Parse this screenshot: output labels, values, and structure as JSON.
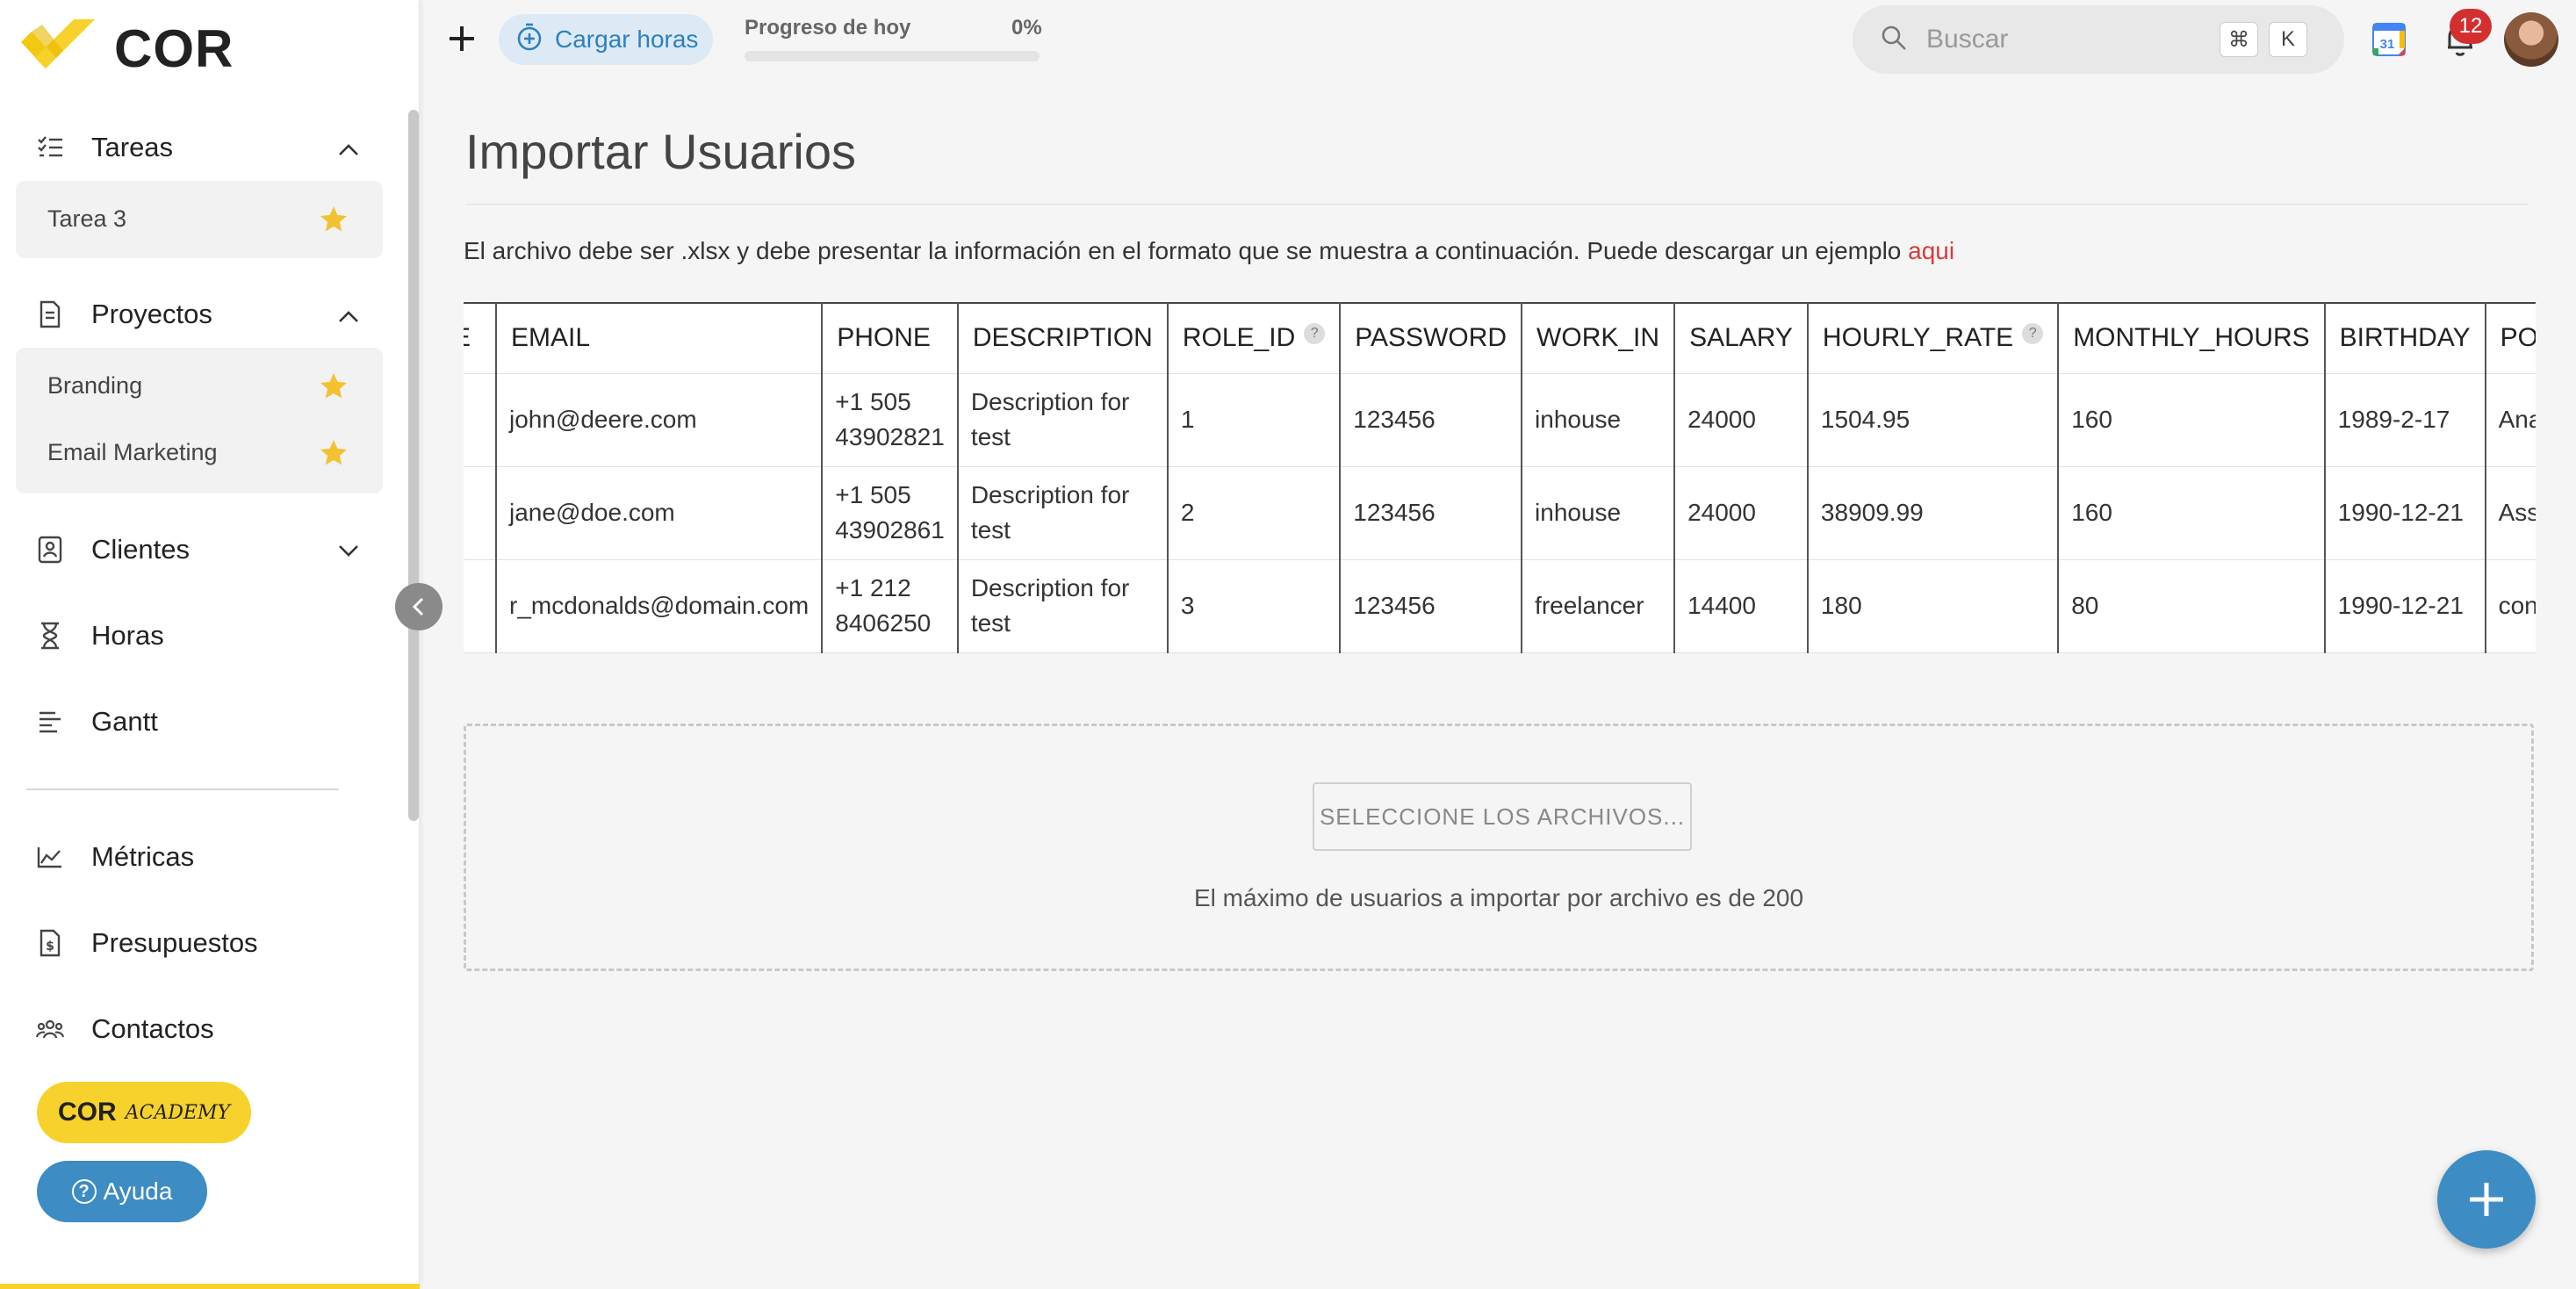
{
  "app": {
    "logo_text": "COR"
  },
  "sidebar": {
    "sections": [
      {
        "label": "Tareas",
        "icon": "task-list-icon",
        "expanded": true
      },
      {
        "label": "Proyectos",
        "icon": "project-doc-icon",
        "expanded": true
      },
      {
        "label": "Clientes",
        "icon": "client-card-icon",
        "expanded": false
      },
      {
        "label": "Horas",
        "icon": "hourglass-icon"
      },
      {
        "label": "Gantt",
        "icon": "gantt-icon"
      },
      {
        "label": "Métricas",
        "icon": "metrics-chart-icon"
      },
      {
        "label": "Presupuestos",
        "icon": "budget-doc-icon"
      },
      {
        "label": "Contactos",
        "icon": "contacts-icon"
      }
    ],
    "tareas_items": [
      {
        "label": "Tarea 3",
        "starred": true
      }
    ],
    "proyectos_items": [
      {
        "label": "Branding",
        "starred": true
      },
      {
        "label": "Email Marketing",
        "starred": true
      }
    ],
    "academy": {
      "part1": "COR",
      "part2": "ACADEMY"
    },
    "help_label": "Ayuda"
  },
  "topbar": {
    "cargar_label": "Cargar horas",
    "progress_label": "Progreso de hoy",
    "progress_value": "0%",
    "progress_fraction": 0,
    "search_placeholder": "Buscar",
    "shortcut_keys": [
      "⌘",
      "K"
    ],
    "calendar_day": "31",
    "notifications_count": "12"
  },
  "main": {
    "title": "Importar Usuarios",
    "instructions": "El archivo debe ser .xlsx y debe presentar la información en el formato que se muestra a continuación. Puede descargar un ejemplo",
    "instructions_link": "aqui",
    "table": {
      "columns": [
        "E",
        "EMAIL",
        "PHONE",
        "DESCRIPTION",
        "ROLE_ID",
        "PASSWORD",
        "WORK_IN",
        "SALARY",
        "HOURLY_RATE",
        "MONTHLY_HOURS",
        "BIRTHDAY",
        "POSITION"
      ],
      "rows": [
        [
          "",
          "john@deere.com",
          "+1 505 43902821",
          "Description for test",
          "1",
          "123456",
          "inhouse",
          "24000",
          "1504.95",
          "160",
          "1989-2-17",
          "Analyst"
        ],
        [
          "",
          "jane@doe.com",
          "+1 505 43902861",
          "Description for test",
          "2",
          "123456",
          "inhouse",
          "24000",
          "38909.99",
          "160",
          "1990-12-21",
          "Assistant"
        ],
        [
          "",
          "r_mcdonalds@domain.com",
          "+1 212 8406250",
          "Description for test",
          "3",
          "123456",
          "freelancer",
          "14400",
          "180",
          "80",
          "1990-12-21",
          "consultant"
        ]
      ]
    },
    "select_button": "SELECCIONE LOS ARCHIVOS...",
    "max_note": "El máximo de usuarios a importar por archivo es de 200"
  },
  "colors": {
    "brand_yellow": "#f7d22c",
    "accent_blue": "#3d8cc3",
    "link_red": "#d63c3c",
    "badge_red": "#d32f2f"
  }
}
